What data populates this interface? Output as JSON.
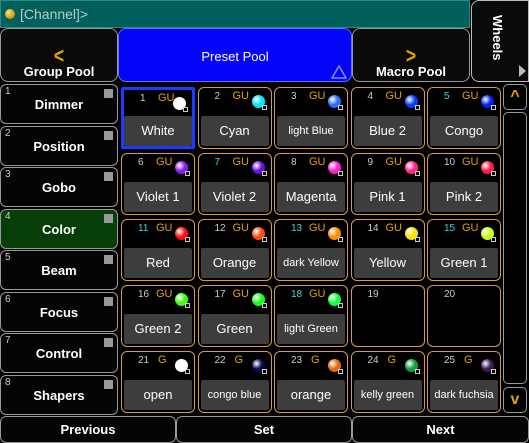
{
  "command_line": {
    "text": "[Channel]>"
  },
  "wheels": {
    "label": "Wheels"
  },
  "pools": {
    "group": {
      "label": "Group Pool"
    },
    "preset": {
      "label": "Preset Pool"
    },
    "macro": {
      "label": "Macro Pool"
    }
  },
  "sidebar": [
    {
      "num": "1",
      "label": "Dimmer"
    },
    {
      "num": "2",
      "label": "Position"
    },
    {
      "num": "3",
      "label": "Gobo"
    },
    {
      "num": "4",
      "label": "Color",
      "active": true
    },
    {
      "num": "5",
      "label": "Beam"
    },
    {
      "num": "6",
      "label": "Focus"
    },
    {
      "num": "7",
      "label": "Control"
    },
    {
      "num": "8",
      "label": "Shapers"
    }
  ],
  "presets": [
    {
      "num": "1",
      "tag": "GU",
      "name": "White",
      "color": "#ffffff",
      "selected": true
    },
    {
      "num": "2",
      "tag": "GU",
      "name": "Cyan",
      "color": "#00e5ff"
    },
    {
      "num": "3",
      "tag": "GU",
      "name": "light Blue",
      "color": "#2a6cff"
    },
    {
      "num": "4",
      "tag": "GU",
      "name": "Blue 2",
      "color": "#0a3cff"
    },
    {
      "num": "5",
      "tag": "GU",
      "name": "Congo",
      "color": "#0022ee",
      "cyan_num": true
    },
    {
      "num": "6",
      "tag": "GU",
      "name": "Violet 1",
      "color": "#8a1ee8"
    },
    {
      "num": "7",
      "tag": "GU",
      "name": "Violet 2",
      "color": "#6a10d8",
      "cyan_num": true
    },
    {
      "num": "8",
      "tag": "GU",
      "name": "Magenta",
      "color": "#ff1fcf"
    },
    {
      "num": "9",
      "tag": "GU",
      "name": "Pink 1",
      "color": "#ff2a80"
    },
    {
      "num": "10",
      "tag": "GU",
      "name": "Pink 2",
      "color": "#ff1a4a"
    },
    {
      "num": "11",
      "tag": "GU",
      "name": "Red",
      "color": "#ff1010",
      "cyan_num": true
    },
    {
      "num": "12",
      "tag": "GU",
      "name": "Orange",
      "color": "#ff4a10"
    },
    {
      "num": "13",
      "tag": "GU",
      "name": "dark Yellow",
      "color": "#ff8c00",
      "cyan_num": true
    },
    {
      "num": "14",
      "tag": "GU",
      "name": "Yellow",
      "color": "#ffe000"
    },
    {
      "num": "15",
      "tag": "GU",
      "name": "Green 1",
      "color": "#c8ff10",
      "cyan_num": true
    },
    {
      "num": "16",
      "tag": "GU",
      "name": "Green 2",
      "color": "#3aff10"
    },
    {
      "num": "17",
      "tag": "GU",
      "name": "Green",
      "color": "#10ff20"
    },
    {
      "num": "18",
      "tag": "GU",
      "name": "light Green",
      "color": "#10ff40",
      "cyan_num": true
    },
    {
      "num": "19",
      "tag": "",
      "name": "",
      "color": ""
    },
    {
      "num": "20",
      "tag": "",
      "name": "",
      "color": ""
    },
    {
      "num": "21",
      "tag": "G",
      "name": "open",
      "color": "#ffffff"
    },
    {
      "num": "22",
      "tag": "G",
      "name": "congo blue",
      "color": "#0a0a50"
    },
    {
      "num": "23",
      "tag": "G",
      "name": "orange",
      "color": "#e06a10"
    },
    {
      "num": "24",
      "tag": "G",
      "name": "kelly green",
      "color": "#10a040"
    },
    {
      "num": "25",
      "tag": "G",
      "name": "dark fuchsia",
      "color": "#3a1a50"
    }
  ],
  "scroll": {
    "up": "^",
    "down": "v"
  },
  "bottom": {
    "previous": "Previous",
    "set": "Set",
    "next": "Next"
  }
}
